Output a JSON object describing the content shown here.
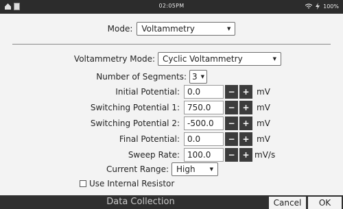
{
  "status": {
    "time": "02:05PM",
    "battery": "100%"
  },
  "mode": {
    "label": "Mode:",
    "value": "Voltammetry"
  },
  "voltammetry_mode": {
    "label": "Voltammetry Mode:",
    "value": "Cyclic Voltammetry"
  },
  "segments": {
    "label": "Number of Segments:",
    "value": "3"
  },
  "fields": [
    {
      "label": "Initial Potential:",
      "value": "0.0",
      "unit": "mV"
    },
    {
      "label": "Switching Potential 1:",
      "value": "750.0",
      "unit": "mV"
    },
    {
      "label": "Switching Potential 2:",
      "value": "-500.0",
      "unit": "mV"
    },
    {
      "label": "Final Potential:",
      "value": "0.0",
      "unit": "mV"
    },
    {
      "label": "Sweep Rate:",
      "value": "100.0",
      "unit": "mV/s"
    }
  ],
  "stepper": {
    "minus": "−",
    "plus": "+"
  },
  "current_range": {
    "label": "Current Range:",
    "value": "High"
  },
  "internal_resistor": {
    "label": "Use Internal Resistor",
    "checked": false
  },
  "bottom": {
    "title": "Data Collection",
    "cancel": "Cancel",
    "ok": "OK"
  }
}
